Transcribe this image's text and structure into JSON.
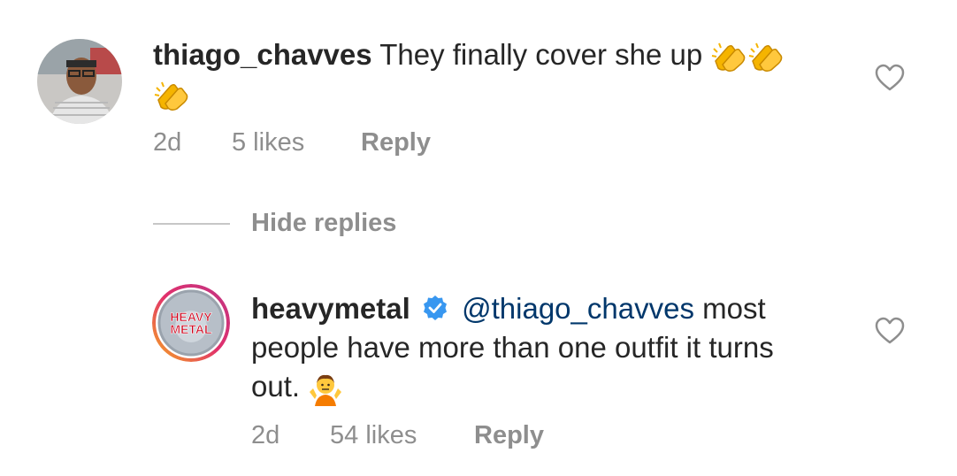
{
  "comment": {
    "username": "thiago_chavves",
    "text": "They finally cover she up",
    "emoji_name": "clapping-hands-icon",
    "time": "2d",
    "likes": "5 likes",
    "reply_label": "Reply"
  },
  "hide_replies_label": "Hide replies",
  "reply": {
    "username": "heavymetal",
    "verified": true,
    "mention": "@thiago_chavves",
    "text_line1": "most",
    "text_line2": "people have more than one outfit it turns",
    "text_line3": "out.",
    "emoji_name": "person-shrugging-icon",
    "time": "2d",
    "likes": "54 likes",
    "reply_label": "Reply",
    "avatar_logo_text": [
      "HEAVY",
      "METAL"
    ]
  },
  "colors": {
    "text": "#262626",
    "meta": "#8e8e8e",
    "verified": "#3897f0",
    "mention": "#00376b",
    "divider": "#c7c7c7"
  }
}
